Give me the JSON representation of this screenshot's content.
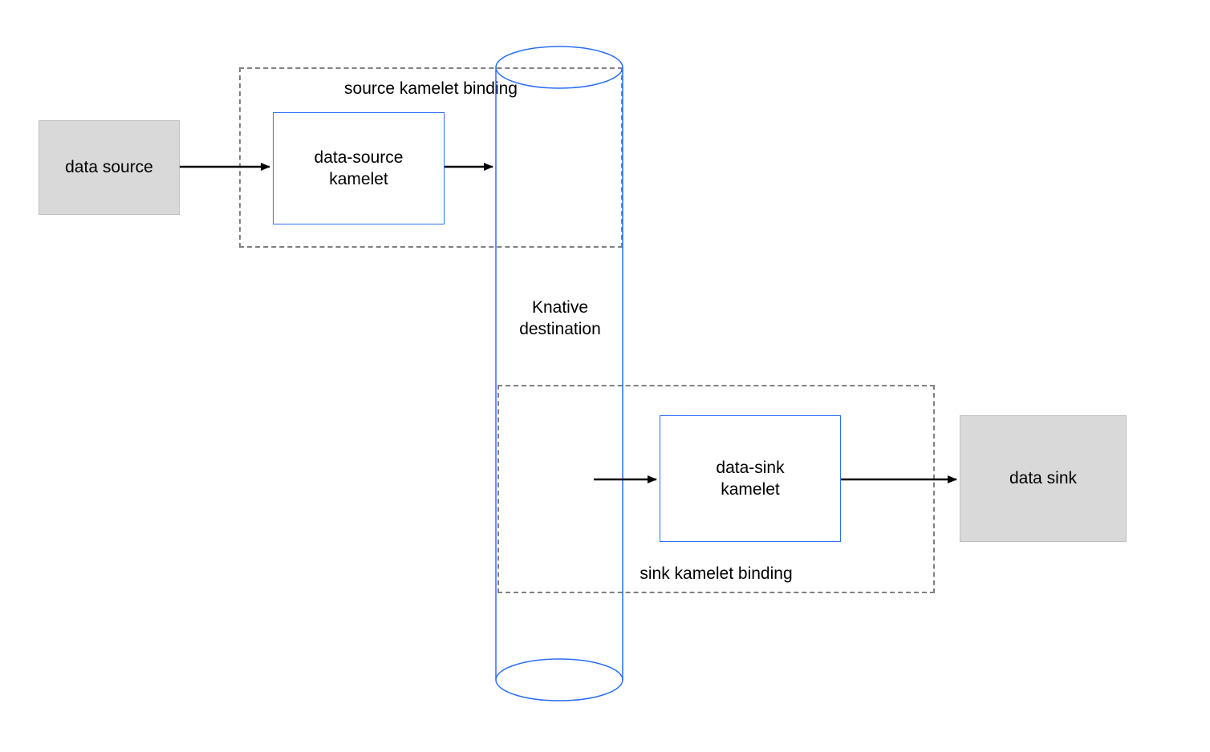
{
  "nodes": {
    "data_source": "data source",
    "data_sink": "data sink",
    "source_kamelet": "data-source\nkamelet",
    "sink_kamelet": "data-sink\nkamelet",
    "source_binding": "source kamelet binding",
    "sink_binding": "sink kamelet binding",
    "knative": "Knative\ndestination"
  },
  "colors": {
    "grey_fill": "#d9d9d9",
    "blue_stroke": "#2a6ef5",
    "dash_stroke": "#808080",
    "arrow": "#000000"
  }
}
